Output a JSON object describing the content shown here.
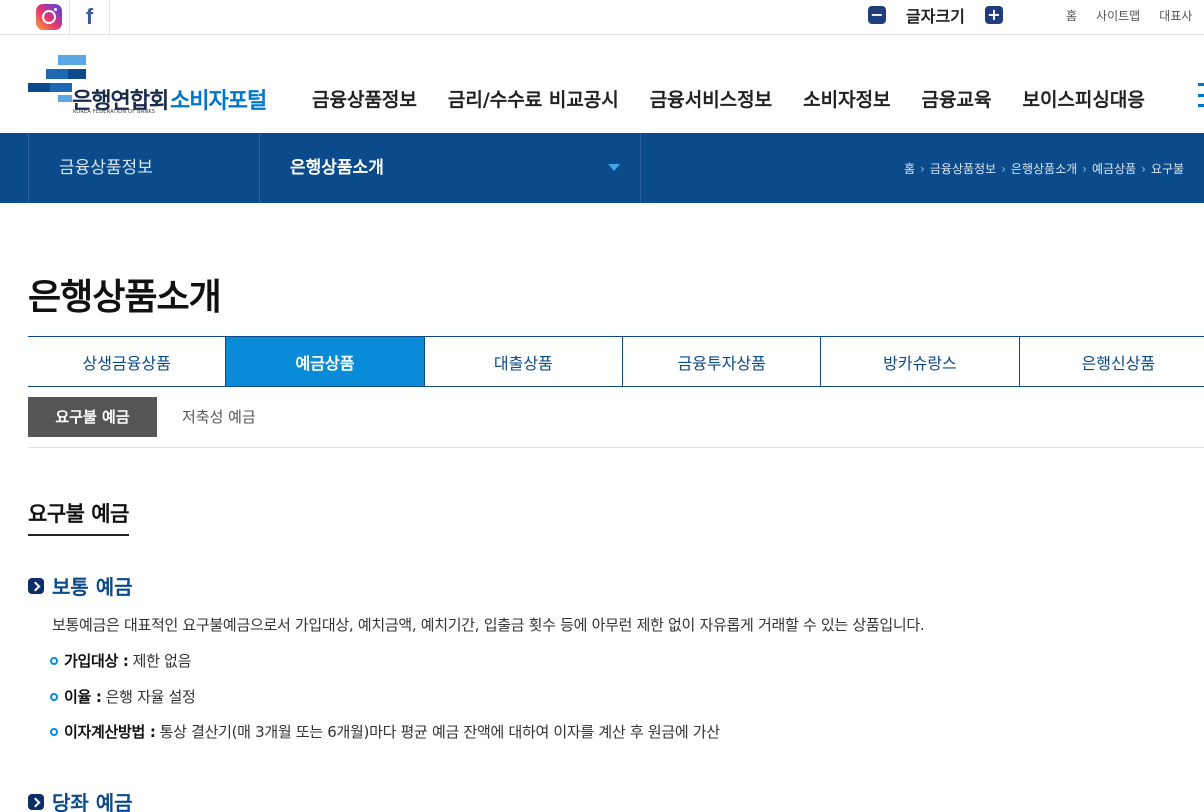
{
  "topbar": {
    "sns": [
      {
        "icon": "instagram-icon"
      },
      {
        "icon": "facebook-icon",
        "glyph": "f"
      }
    ],
    "font_size_label": "글자크기",
    "font_minus": "−",
    "font_plus": "+",
    "links": [
      "홈",
      "사이트맵",
      "대표사"
    ]
  },
  "header": {
    "brand": "은행연합회",
    "brand_sub": "KOREA FEDERATION OF BANKS",
    "portal": "소비자포털",
    "nav": [
      "금융상품정보",
      "금리/수수료 비교공시",
      "금융서비스정보",
      "소비자정보",
      "금융교육",
      "보이스피싱대응"
    ]
  },
  "location": {
    "depth1": "금융상품정보",
    "depth2": "은행상품소개",
    "breadcrumb": [
      "홈",
      "금융상품정보",
      "은행상품소개",
      "예금상품",
      "요구불"
    ]
  },
  "page_title": "은행상품소개",
  "tabs": [
    {
      "label": "상생금융상품",
      "active": false
    },
    {
      "label": "예금상품",
      "active": true
    },
    {
      "label": "대출상품",
      "active": false
    },
    {
      "label": "금융투자상품",
      "active": false
    },
    {
      "label": "방카슈랑스",
      "active": false
    },
    {
      "label": "은행신상품",
      "active": false
    }
  ],
  "subtabs": [
    {
      "label": "요구불 예금",
      "active": true
    },
    {
      "label": "저축성 예금",
      "active": false
    }
  ],
  "section": {
    "title": "요구불 예금",
    "items": [
      {
        "heading": "보통 예금",
        "description": "보통예금은 대표적인 요구불예금으로서 가입대상, 예치금액, 예치기간, 입출금 횟수 등에 아무런 제한 없이 자유롭게 거래할 수 있는 상품입니다.",
        "details": [
          {
            "label": "가입대상 :",
            "value": "제한 없음"
          },
          {
            "label": "이율 :",
            "value": "은행 자율 설정"
          },
          {
            "label": "이자계산방법 :",
            "value": "통상 결산기(매 3개월 또는 6개월)마다 평균 예금 잔액에 대하여 이자를 계산 후 원금에 가산"
          }
        ]
      },
      {
        "heading": "당좌 예금"
      }
    ]
  },
  "colors": {
    "navy": "#0b4a8b",
    "accent_blue": "#0a8bd7",
    "portal_blue": "#0077c8",
    "subtab_gray": "#555555"
  }
}
